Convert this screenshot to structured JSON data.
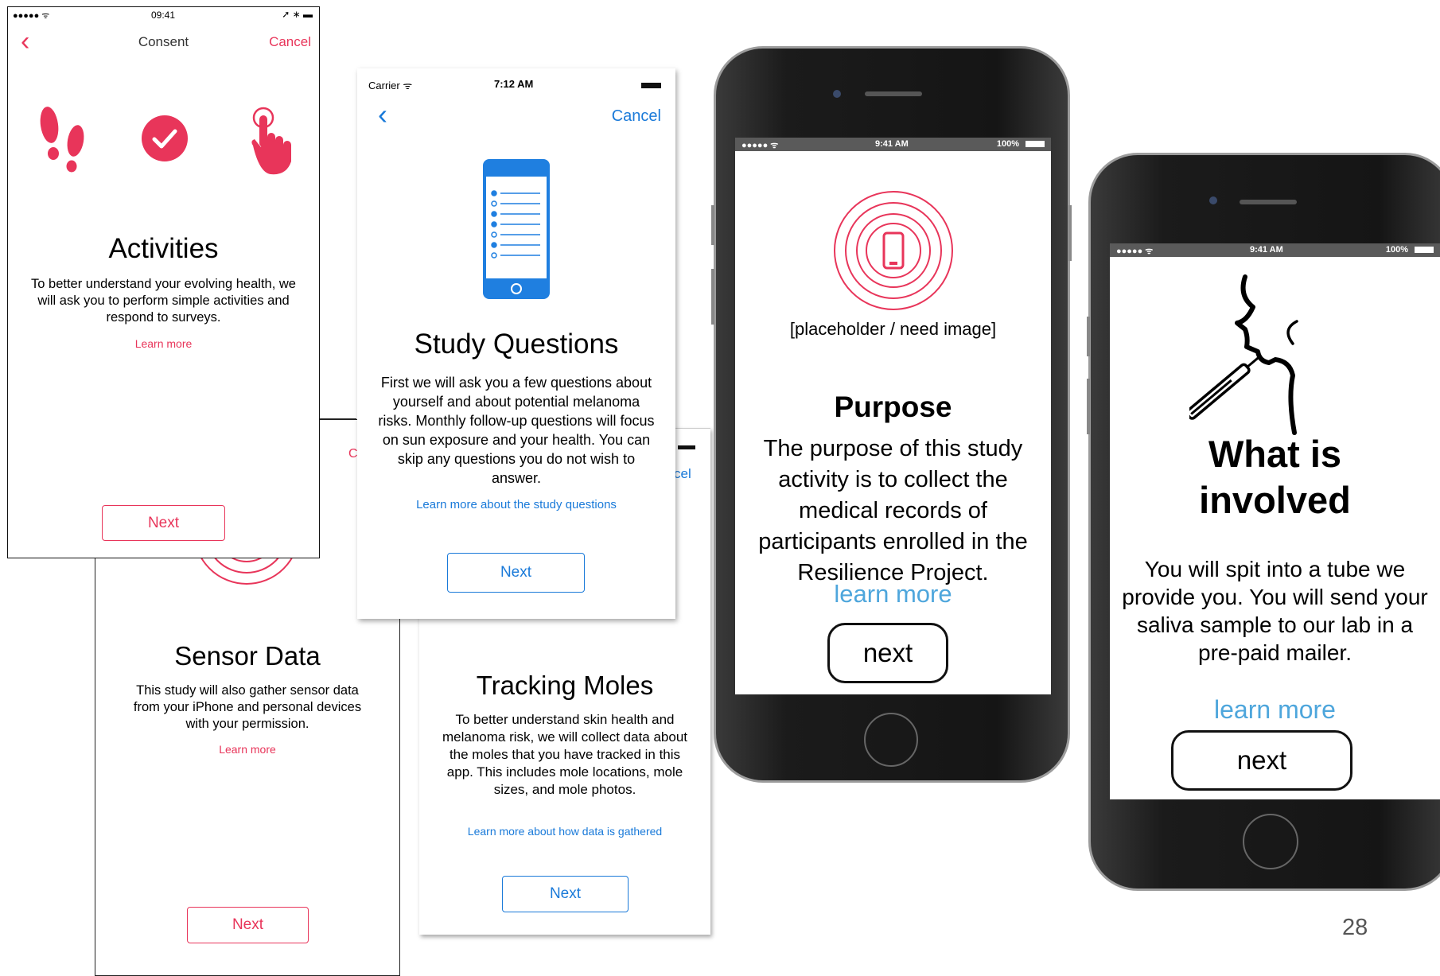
{
  "s1": {
    "carrier": "●●●●● ᯤ",
    "time": "09:41",
    "battery": "➚ ∗ ▬",
    "back": "‹",
    "title": "Consent",
    "cancel": "Cancel",
    "heading": "Activities",
    "body": "To better understand your evolving health, we will ask you to perform simple activities and respond to surveys.",
    "link": "Learn more",
    "button": "Next"
  },
  "s2": {
    "carrier": "Carrier ᯤ",
    "time": "7:12 AM",
    "back": "‹",
    "cancel": "Cancel",
    "heading": "Study Questions",
    "body": "First we will ask you a few questions about yourself and about potential melanoma risks. Monthly follow-up questions will focus on sun exposure and your health. You can skip any questions you do not wish to answer.",
    "link": "Learn more about the study questions",
    "button": "Next"
  },
  "s3": {
    "heading": "Sensor Data",
    "body": "This study will also gather sensor data from your iPhone and personal devices with your permission.",
    "link": "Learn more",
    "button": "Next",
    "peek_c": "C"
  },
  "s4": {
    "heading": "Tracking Moles",
    "body": "To better understand skin health and melanoma risk, we will collect data about the moles that you have tracked in this app. This includes mole locations, mole sizes, and mole photos.",
    "link": "Learn more about how data is gathered",
    "button": "Next",
    "peek_cancel": "cel"
  },
  "phone1": {
    "carrier": "●●●●● ᯤ",
    "time": "9:41 AM",
    "battery": "100%",
    "placeholder": "[placeholder / need image]",
    "heading": "Purpose",
    "body": "The purpose of this study activity is to collect the medical records of participants enrolled in the Resilience Project.",
    "link": "learn more",
    "button": "next"
  },
  "phone2": {
    "carrier": "●●●●● ᯤ",
    "time": "9:41 AM",
    "battery": "100%",
    "heading": "What is involved",
    "body": "You will spit into a tube we provide you. You will send your saliva sample to our lab in a pre-paid mailer.",
    "link": "learn more",
    "button": "next"
  },
  "page_number": "28",
  "colors": {
    "accent_pink": "#e8355a",
    "accent_blue": "#1a7ad9",
    "mock_link": "#4ea6dc"
  },
  "icons": [
    "footsteps-icon",
    "checkmark-circle-icon",
    "tap-hand-icon",
    "phone-checklist-icon",
    "phone-rings-icon",
    "saliva-tube-icon"
  ]
}
